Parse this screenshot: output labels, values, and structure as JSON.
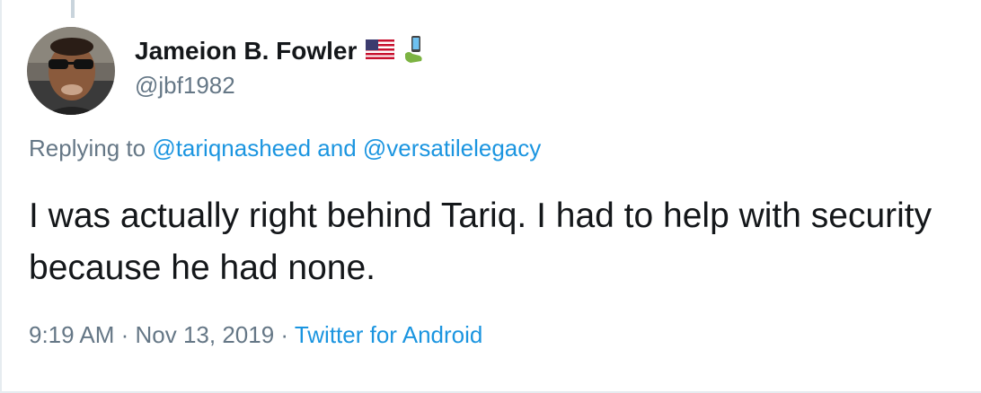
{
  "tweet": {
    "author": {
      "display_name": "Jameion B. Fowler",
      "handle": "@jbf1982",
      "name_emojis": [
        "us-flag-icon",
        "phone-in-hand-icon"
      ]
    },
    "replying": {
      "prefix": "Replying to ",
      "mention1": "@tariqnasheed",
      "connector": " and ",
      "mention2": "@versatilelegacy"
    },
    "text": "I was actually right behind Tariq. I had to help with security because he had none.",
    "time": "9:19 AM",
    "separator1": " · ",
    "date": "Nov 13, 2019",
    "separator2": " · ",
    "source": "Twitter for Android"
  },
  "colors": {
    "link": "#1b95e0",
    "muted": "#657786",
    "text": "#14171a"
  }
}
